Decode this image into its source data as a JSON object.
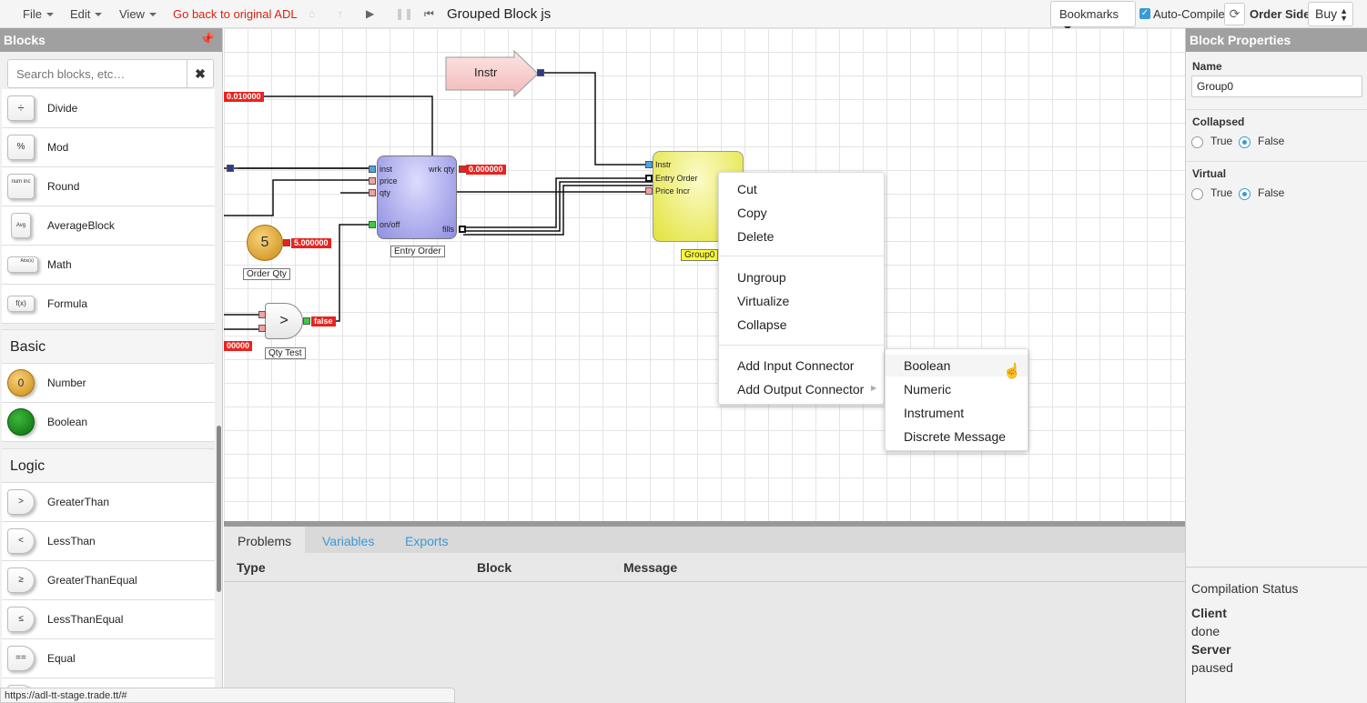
{
  "topbar": {
    "menus": [
      "File",
      "Edit",
      "View"
    ],
    "back_link": "Go back to original ADL",
    "doc_title": "Grouped Block js",
    "bookmarks": "Bookmarks",
    "auto_compile": "Auto-Compile",
    "order_side_label": "Order Side",
    "order_side_value": "Buy"
  },
  "left_panel": {
    "title": "Blocks",
    "search_placeholder": "Search blocks, etc…",
    "items_top": [
      {
        "label": "Divide",
        "icon": "÷"
      },
      {
        "label": "Mod",
        "icon": "%"
      },
      {
        "label": "Round",
        "icon": "num inc"
      },
      {
        "label": "AverageBlock",
        "icon": "Avg"
      },
      {
        "label": "Math",
        "icon": "Abs(x)"
      },
      {
        "label": "Formula",
        "icon": "f(x)"
      }
    ],
    "section_basic": "Basic",
    "items_basic": [
      {
        "label": "Number",
        "icon": "0"
      },
      {
        "label": "Boolean",
        "icon": ""
      }
    ],
    "section_logic": "Logic",
    "items_logic": [
      {
        "label": "GreaterThan",
        "icon": ">"
      },
      {
        "label": "LessThan",
        "icon": "<"
      },
      {
        "label": "GreaterThanEqual",
        "icon": "≥"
      },
      {
        "label": "LessThanEqual",
        "icon": "≤"
      },
      {
        "label": "Equal",
        "icon": "=="
      }
    ]
  },
  "canvas": {
    "instr_block": "Instr",
    "entry_order": {
      "label": "Entry Order",
      "ports_in": [
        "inst",
        "price",
        "qty",
        "on/off"
      ],
      "ports_out": [
        "wrk qty",
        "fills"
      ],
      "wrk_qty_value": "0.000000"
    },
    "group_block": {
      "label": "Group0",
      "ports_in": [
        "Instr",
        "Entry Order",
        "Price Incr"
      ]
    },
    "order_qty": {
      "label": "Order Qty",
      "value": "5",
      "out_value": "5.000000"
    },
    "qty_test": {
      "label": "Qty Test",
      "symbol": ">",
      "out_value": "false"
    },
    "left_value_top": "0.010000",
    "left_value_bottom": "00000"
  },
  "context_menu": {
    "items_a": [
      "Cut",
      "Copy",
      "Delete"
    ],
    "items_b": [
      "Ungroup",
      "Virtualize",
      "Collapse"
    ],
    "items_c": [
      "Add Input Connector",
      "Add Output Connector"
    ]
  },
  "submenu": {
    "items": [
      "Boolean",
      "Numeric",
      "Instrument",
      "Discrete Message"
    ]
  },
  "bottom_panel": {
    "tabs": [
      "Problems",
      "Variables",
      "Exports"
    ],
    "columns": [
      "Type",
      "Block",
      "Message"
    ]
  },
  "right_panel": {
    "title": "Block Properties",
    "name_label": "Name",
    "name_value": "Group0",
    "collapsed_label": "Collapsed",
    "virtual_label": "Virtual",
    "true_label": "True",
    "false_label": "False",
    "compilation_title": "Compilation Status",
    "client_label": "Client",
    "client_value": "done",
    "server_label": "Server",
    "server_value": "paused"
  },
  "status_url": "https://adl-tt-stage.trade.tt/#",
  "colors": {
    "accent_blue": "#3a99d9",
    "back_link_red": "#d9230f",
    "value_red": "#e8231f",
    "group_yellow": "#eded6a",
    "entry_order_blue": "#a8a8ec"
  }
}
